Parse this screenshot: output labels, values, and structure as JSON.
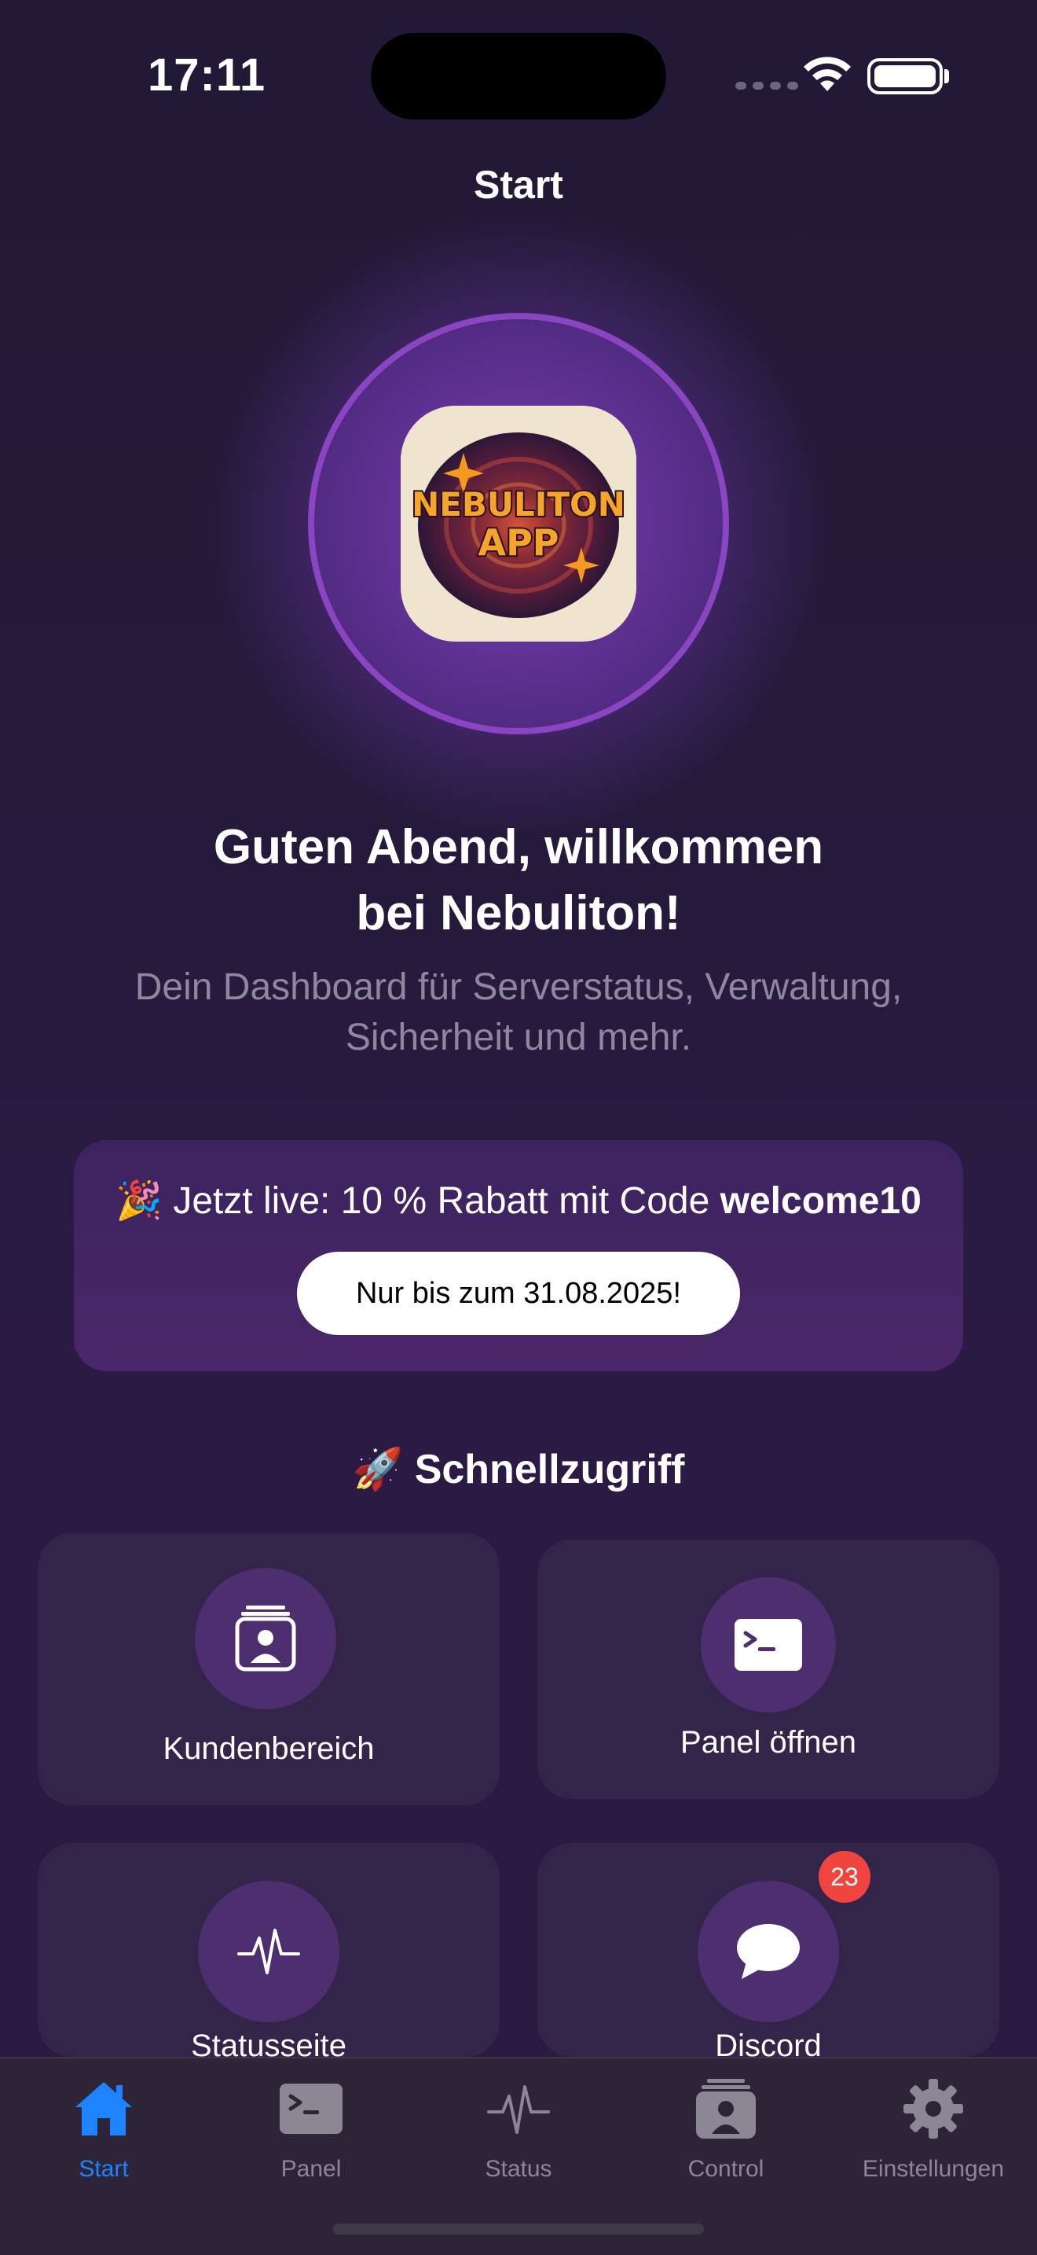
{
  "status_bar": {
    "time": "17:11"
  },
  "nav": {
    "title": "Start"
  },
  "logo": {
    "line1": "NEBULITON",
    "line2": "APP"
  },
  "greeting": {
    "line1": "Guten Abend, willkommen",
    "line2": "bei Nebuliton!",
    "subtitle_line1": "Dein Dashboard für Serverstatus, Verwaltung,",
    "subtitle_line2": "Sicherheit und mehr."
  },
  "promo": {
    "emoji": "🎉",
    "text": "Jetzt live: 10 % Rabatt mit Code",
    "code": "welcome10",
    "button": "Nur bis zum 31.08.2025!"
  },
  "quick_access": {
    "title": "🚀 Schnellzugriff",
    "tiles": [
      {
        "label": "Kundenbereich",
        "icon": "contact-card-icon"
      },
      {
        "label": "Panel öffnen",
        "icon": "terminal-icon"
      },
      {
        "label": "Statusseite",
        "icon": "waveform-icon"
      },
      {
        "label": "Discord",
        "icon": "chat-bubble-icon",
        "badge": "23"
      }
    ]
  },
  "tabbar": {
    "tabs": [
      {
        "label": "Start",
        "icon": "house-icon",
        "active": true
      },
      {
        "label": "Panel",
        "icon": "terminal-icon"
      },
      {
        "label": "Status",
        "icon": "waveform-icon"
      },
      {
        "label": "Control",
        "icon": "contact-card-icon"
      },
      {
        "label": "Einstellungen",
        "icon": "gear-icon"
      }
    ],
    "active_color": "#1e83ff",
    "inactive_color": "#8c8794"
  },
  "colors": {
    "background": "#231a37",
    "accent_purple": "#8a45c2",
    "badge_red": "#f0453f"
  }
}
